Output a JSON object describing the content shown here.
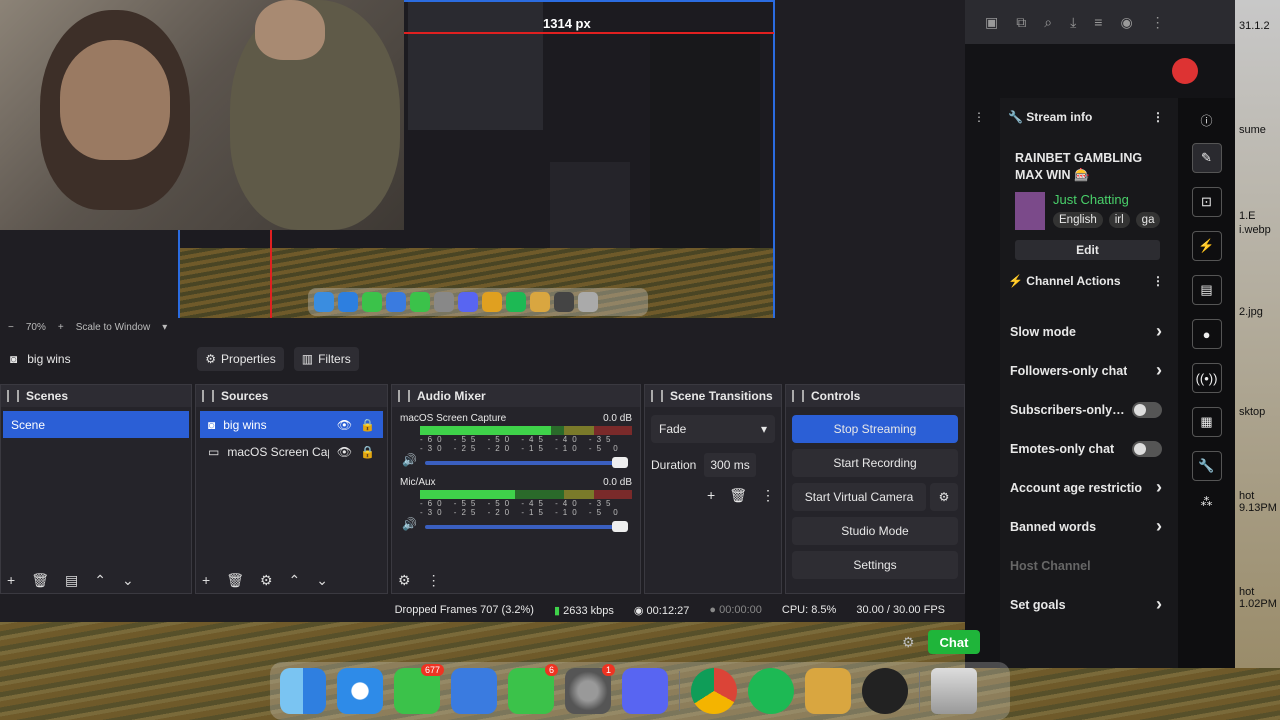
{
  "measure": "1314 px",
  "zoom": {
    "minus": "−",
    "value": "70%",
    "plus": "+",
    "mode": "Scale to Window"
  },
  "source_bar": {
    "source": "big wins",
    "properties": "Properties",
    "filters": "Filters"
  },
  "docks": {
    "scenes": "Scenes",
    "sources": "Sources",
    "mixer": "Audio Mixer",
    "transitions": "Scene Transitions",
    "controls": "Controls"
  },
  "scenes": [
    "Scene"
  ],
  "sources": [
    {
      "name": "big wins",
      "icon": "camera-icon"
    },
    {
      "name": "macOS Screen Capture",
      "icon": "monitor-icon"
    }
  ],
  "mixer": [
    {
      "name": "macOS Screen Capture",
      "db": "0.0 dB",
      "level": 0.62
    },
    {
      "name": "Mic/Aux",
      "db": "0.0 dB",
      "level": 0.45
    }
  ],
  "meter_ticks": "-60 -55 -50 -45 -40 -35 -30 -25 -20 -15 -10 -5 0",
  "transitions": {
    "type": "Fade",
    "duration_label": "Duration",
    "duration": "300 ms"
  },
  "controls": {
    "stop_streaming": "Stop Streaming",
    "start_recording": "Start Recording",
    "start_virtual_camera": "Start Virtual Camera",
    "studio_mode": "Studio Mode",
    "settings": "Settings"
  },
  "status": {
    "dropped": "Dropped Frames 707 (3.2%)",
    "kbps": "2633 kbps",
    "stream_time": "00:12:27",
    "rec_time": "00:00:00",
    "cpu": "CPU: 8.5%",
    "fps": "30.00 / 30.00 FPS"
  },
  "twitch": {
    "stream_info": "Stream info",
    "title": "RAINBET GAMBLING MAX WIN 🎰",
    "category": "Just Chatting",
    "tags": [
      "English",
      "irl",
      "ga"
    ],
    "edit": "Edit",
    "channel_actions": "Channel Actions",
    "actions": [
      {
        "label": "Slow mode",
        "kind": "arrow"
      },
      {
        "label": "Followers-only chat",
        "kind": "arrow"
      },
      {
        "label": "Subscribers-only…",
        "kind": "toggle"
      },
      {
        "label": "Emotes-only chat",
        "kind": "toggle"
      },
      {
        "label": "Account age restrictio",
        "kind": "arrow"
      },
      {
        "label": "Banned words",
        "kind": "arrow"
      },
      {
        "label": "Host Channel",
        "kind": "disabled"
      },
      {
        "label": "Set goals",
        "kind": "arrow"
      }
    ],
    "chat": "Chat"
  },
  "desktop_labels": [
    "31.1.2",
    "sume",
    "1.E",
    "i.webp",
    "2.jpg",
    "sktop",
    "hot",
    "9.13PM",
    "hot",
    "1.02PM"
  ],
  "dock_badges": {
    "messages": "677",
    "facetime": "6",
    "settings": "1"
  },
  "accent": "#2b5fd6",
  "twitch_green": "#1fb53a"
}
